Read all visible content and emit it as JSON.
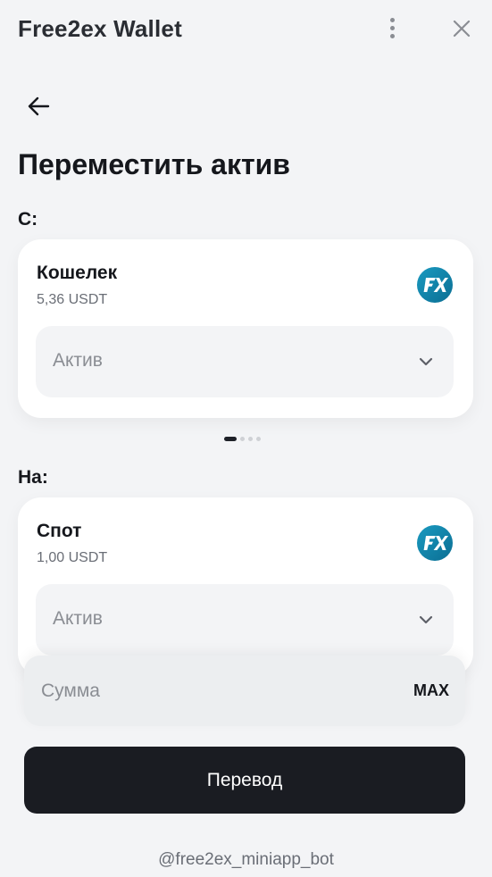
{
  "header": {
    "app_title": "Free2ex Wallet",
    "menu_icon": "more-vertical-icon",
    "close_icon": "close-icon"
  },
  "nav": {
    "back_icon": "arrow-left-icon"
  },
  "page": {
    "title": "Переместить актив"
  },
  "from": {
    "label": "С:",
    "account_name": "Кошелек",
    "balance": "5,36 USDT",
    "logo_text": "FX",
    "asset_placeholder": "Актив"
  },
  "carousel": {
    "pages": 4,
    "active_index": 0
  },
  "to": {
    "label": "На:",
    "account_name": "Спот",
    "balance": "1,00 USDT",
    "logo_text": "FX",
    "asset_placeholder": "Актив"
  },
  "amount": {
    "placeholder": "Сумма",
    "max_label": "MAX"
  },
  "submit": {
    "label": "Перевод"
  },
  "footer": {
    "bot_handle": "@free2ex_miniapp_bot"
  },
  "colors": {
    "background": "#f3f4f6",
    "card": "#ffffff",
    "primary_button": "#1a1c22",
    "logo_gradient_start": "#1a9ac0",
    "logo_gradient_end": "#0b6e93"
  }
}
